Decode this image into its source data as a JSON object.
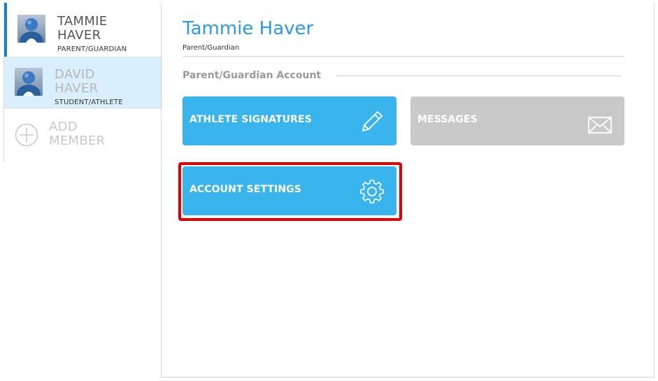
{
  "sidebar": {
    "members": [
      {
        "first": "TAMMIE",
        "last": "HAVER",
        "role": "PARENT/GUARDIAN",
        "active": true
      },
      {
        "first": "DAVID",
        "last": "HAVER",
        "role": "STUDENT/ATHLETE",
        "active": false
      }
    ],
    "add": {
      "line1": "ADD",
      "line2": "MEMBER"
    }
  },
  "main": {
    "title": "Tammie Haver",
    "subtitle": "Parent/Guardian",
    "section": "Parent/Guardian Account",
    "tiles": [
      {
        "label": "ATHLETE SIGNATURES",
        "icon": "pencil-icon"
      },
      {
        "label": "MESSAGES",
        "icon": "envelope-icon"
      },
      {
        "label": "ACCOUNT SETTINGS",
        "icon": "gear-icon"
      }
    ]
  },
  "colors": {
    "accent": "#3ab4ec",
    "title": "#2a9be0",
    "disabled_tile": "#c9c9c9",
    "highlight": "#e00000",
    "active_bar": "#1f7fc2",
    "selected_row": "#d9effd"
  }
}
